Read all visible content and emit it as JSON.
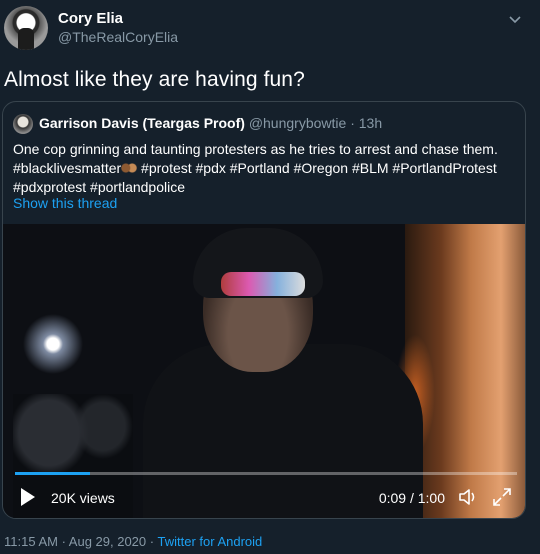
{
  "tweet": {
    "author_name": "Cory Elia",
    "author_handle": "@TheRealCoryElia",
    "text": "Almost like they are having fun?",
    "timestamp": "11:15 AM · Aug 29, 2020",
    "separator": " · ",
    "source": "Twitter for Android"
  },
  "quoted_tweet": {
    "author_name": "Garrison Davis (Teargas Proof)",
    "author_handle": "@hungrybowtie",
    "time_ago": "13h",
    "text_part1": "One cop grinning and taunting protesters as he tries to arrest and chase them. #blacklivesmatter",
    "text_part2": " #protest #pdx #Portland #Oregon #BLM #PortlandProtest #pdxprotest #portlandpolice",
    "show_thread": "Show this thread"
  },
  "video": {
    "views": "20K views",
    "time": "0:09 / 1:00",
    "progress": 0.15
  },
  "colors": {
    "background": "#15202b",
    "accent": "#1da1f2",
    "secondary_text": "#8899a6",
    "border": "#38444d"
  },
  "icons": [
    "chevron-down-icon",
    "play-icon",
    "volume-icon",
    "fullscreen-icon",
    "raised-fist-emoji"
  ]
}
